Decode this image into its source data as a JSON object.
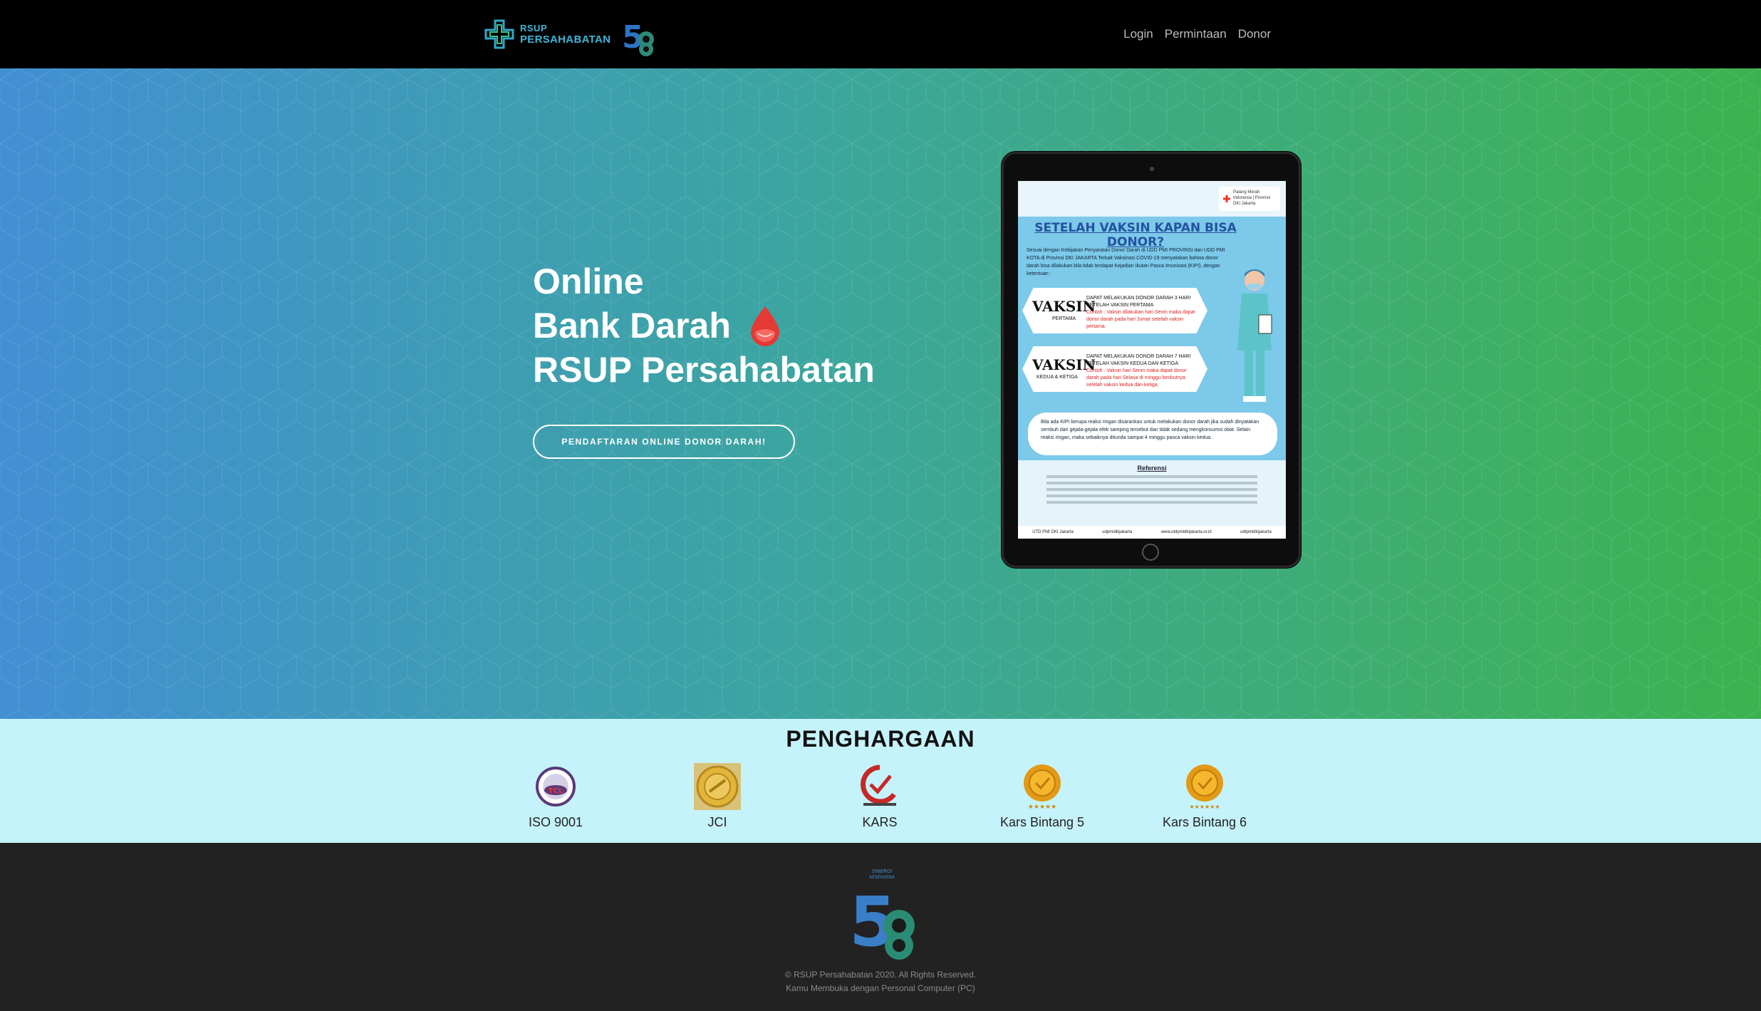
{
  "navbar": {
    "brand_line1": "RSUP",
    "brand_line2": "PERSAHABATAN",
    "links": [
      "Login",
      "Permintaan",
      "Donor"
    ]
  },
  "hero": {
    "title_lines": [
      "Online",
      "Bank Darah",
      "RSUP Persahabatan"
    ],
    "cta_label": "PENDAFTARAN ONLINE DONOR DARAH!",
    "poster": {
      "logo_text": "Palang Merah Indonesia | Provinsi DKI Jakarta",
      "title": "SETELAH VAKSIN KAPAN BISA DONOR?",
      "intro": "Sesuai dengan Kebijakan Penyaratan Donor Darah di UDD PMI PROVINSI dan UDD PMI KOTA di Provinsi DKI JAKARTA Terkait Vaksinasi COVID-19 menyatakan bahwa donor darah bisa dilakukan bila tidak terdapat Kejadian Ikutan Pasca Imunisasi (KIPI), dengan ketentuan :",
      "box1": {
        "big": "VAKSIN",
        "small": "PERTAMA",
        "desc": "DAPAT MELAKUKAN DONOR DARAH 3 HARI SETELAH VAKSIN PERTAMA",
        "example": "Contoh : Vaksin dilakukan hari Senin maka dapat donor darah pada hari Jumat setelah vaksin pertama."
      },
      "box2": {
        "big": "VAKSIN",
        "small": "KEDUA & KETIGA",
        "desc": "DAPAT MELAKUKAN DONOR DARAH 7 HARI SETELAH VAKSIN KEDUA DAN KETIGA",
        "example": "Contoh : Vaksin hari Senin maka dapat donor darah pada hari Selasa di minggu berikutnya setelah vaksin kedua dan ketiga."
      },
      "note": "Bila ada KIPI berupa reaksi ringan disarankan untuk melakukan donor darah jika sudah dinyatakan sembuh dari gejala-gejala efek samping tersebut dan tidak sedang mengkonsumsi obat. Selain reaksi ringan, maka sebaiknya ditunda sampai 4 minggu pasca vaksin kedua.",
      "ref_title": "Referensi",
      "footer_items": [
        "UTD PMI DKI Jakarta",
        "udpmidkijakarta",
        "www.utdpmidkijakarta.or.id",
        "udtpmidkijakarta"
      ]
    }
  },
  "awards": {
    "title": "PENGHARGAAN",
    "items": [
      {
        "label": "ISO 9001",
        "icon": "tcl-iso-icon"
      },
      {
        "label": "JCI",
        "icon": "jci-gold-seal-icon"
      },
      {
        "label": "KARS",
        "icon": "kars-logo-icon"
      },
      {
        "label": "Kars Bintang 5",
        "icon": "kars-5-star-medal-icon"
      },
      {
        "label": "Kars Bintang 6",
        "icon": "kars-6-star-medal-icon"
      }
    ]
  },
  "footer": {
    "copyright": "© RSUP Persahabatan 2020. All Rights Reserved.",
    "device_note": "Kamu Membuka dengan Personal Computer (PC)"
  },
  "colors": {
    "navbar_bg": "#000000",
    "hero_gradient_start": "#428fd4",
    "hero_gradient_end": "#3cb24f",
    "awards_bg": "#c5f3fc",
    "footer_bg": "#222222",
    "brand_accent": "#3fb6d9",
    "drop_red": "#e53935"
  }
}
